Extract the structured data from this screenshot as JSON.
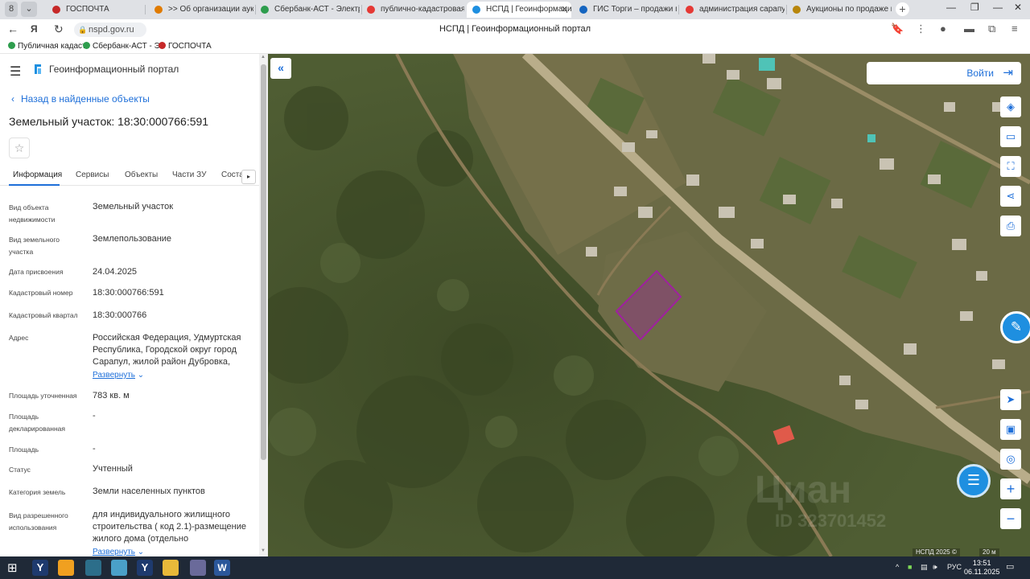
{
  "browser": {
    "tabs": [
      {
        "label": "ГОСПОЧТА",
        "icon": "gospochta-icon",
        "color": "#c62828"
      },
      {
        "label": ">> Об организации аукцио",
        "icon": "document-icon",
        "color": "#e07b00"
      },
      {
        "label": "Сбербанк-АСТ - Электрон",
        "icon": "sberbank-icon",
        "color": "#2e9d4d"
      },
      {
        "label": "публично-кадастровая к",
        "icon": "yandex-icon",
        "color": "#e53935"
      },
      {
        "label": "НСПД | Геоинформацио",
        "icon": "nspd-icon",
        "color": "#1e8fe0",
        "active": true
      },
      {
        "label": "ГИС Торги – продажи гос",
        "icon": "gis-torgi-icon",
        "color": "#1565c0"
      },
      {
        "label": "администрация сарапуль",
        "icon": "yandex-icon",
        "color": "#e53935"
      },
      {
        "label": "Аукционы по продаже пр",
        "icon": "auction-icon",
        "color": "#b8860b"
      }
    ],
    "tab_counter": "8",
    "url": "nspd.gov.ru",
    "page_title": "НСПД | Геоинформационный портал",
    "bookmarks": [
      {
        "label": "Публичная кадаст",
        "color": "#2e9d4d"
      },
      {
        "label": "Сбербанк-АСТ - Э",
        "color": "#2e9d4d"
      },
      {
        "label": "ГОСПОЧТА",
        "color": "#c62828"
      }
    ]
  },
  "panel": {
    "portal_name": "Геоинформационный портал",
    "back_link": "Назад в найденные объекты",
    "title": "Земельный участок: 18:30:000766:591",
    "tabs": [
      "Информация",
      "Сервисы",
      "Объекты",
      "Части ЗУ",
      "Соста"
    ],
    "fields": [
      {
        "label": "Вид объекта недвижимости",
        "value": "Земельный участок"
      },
      {
        "label": "Вид земельного участка",
        "value": "Землепользование"
      },
      {
        "label": "Дата присвоения",
        "value": "24.04.2025"
      },
      {
        "label": "Кадастровый номер",
        "value": "18:30:000766:591"
      },
      {
        "label": "Кадастровый квартал",
        "value": "18:30:000766"
      },
      {
        "label": "Адрес",
        "value": "Российская Федерация, Удмуртская Республика, Городской округ город Сарапул, жилой район Дубровка,"
      },
      {
        "label": "Площадь уточненная",
        "value": "783 кв. м"
      },
      {
        "label": "Площадь декларированная",
        "value": "-"
      },
      {
        "label": "Площадь",
        "value": "-"
      },
      {
        "label": "Статус",
        "value": "Учтенный"
      },
      {
        "label": "Категория земель",
        "value": "Земли населенных пунктов"
      },
      {
        "label": "Вид разрешенного использования",
        "value": "для индивидуального жилищного строительства ( код 2.1)-размещение жилого дома (отдельно"
      }
    ],
    "expand_label": "Развернуть"
  },
  "map": {
    "login_label": "Войти",
    "attribution": "НСПД 2025 ©",
    "scale": "20 м",
    "watermark": "Циан",
    "watermark_id": "ID 323701452",
    "parcel_color": "#a020a0"
  },
  "taskbar": {
    "tray_lang": "РУС",
    "time": "13:51",
    "date": "06.11.2025"
  }
}
